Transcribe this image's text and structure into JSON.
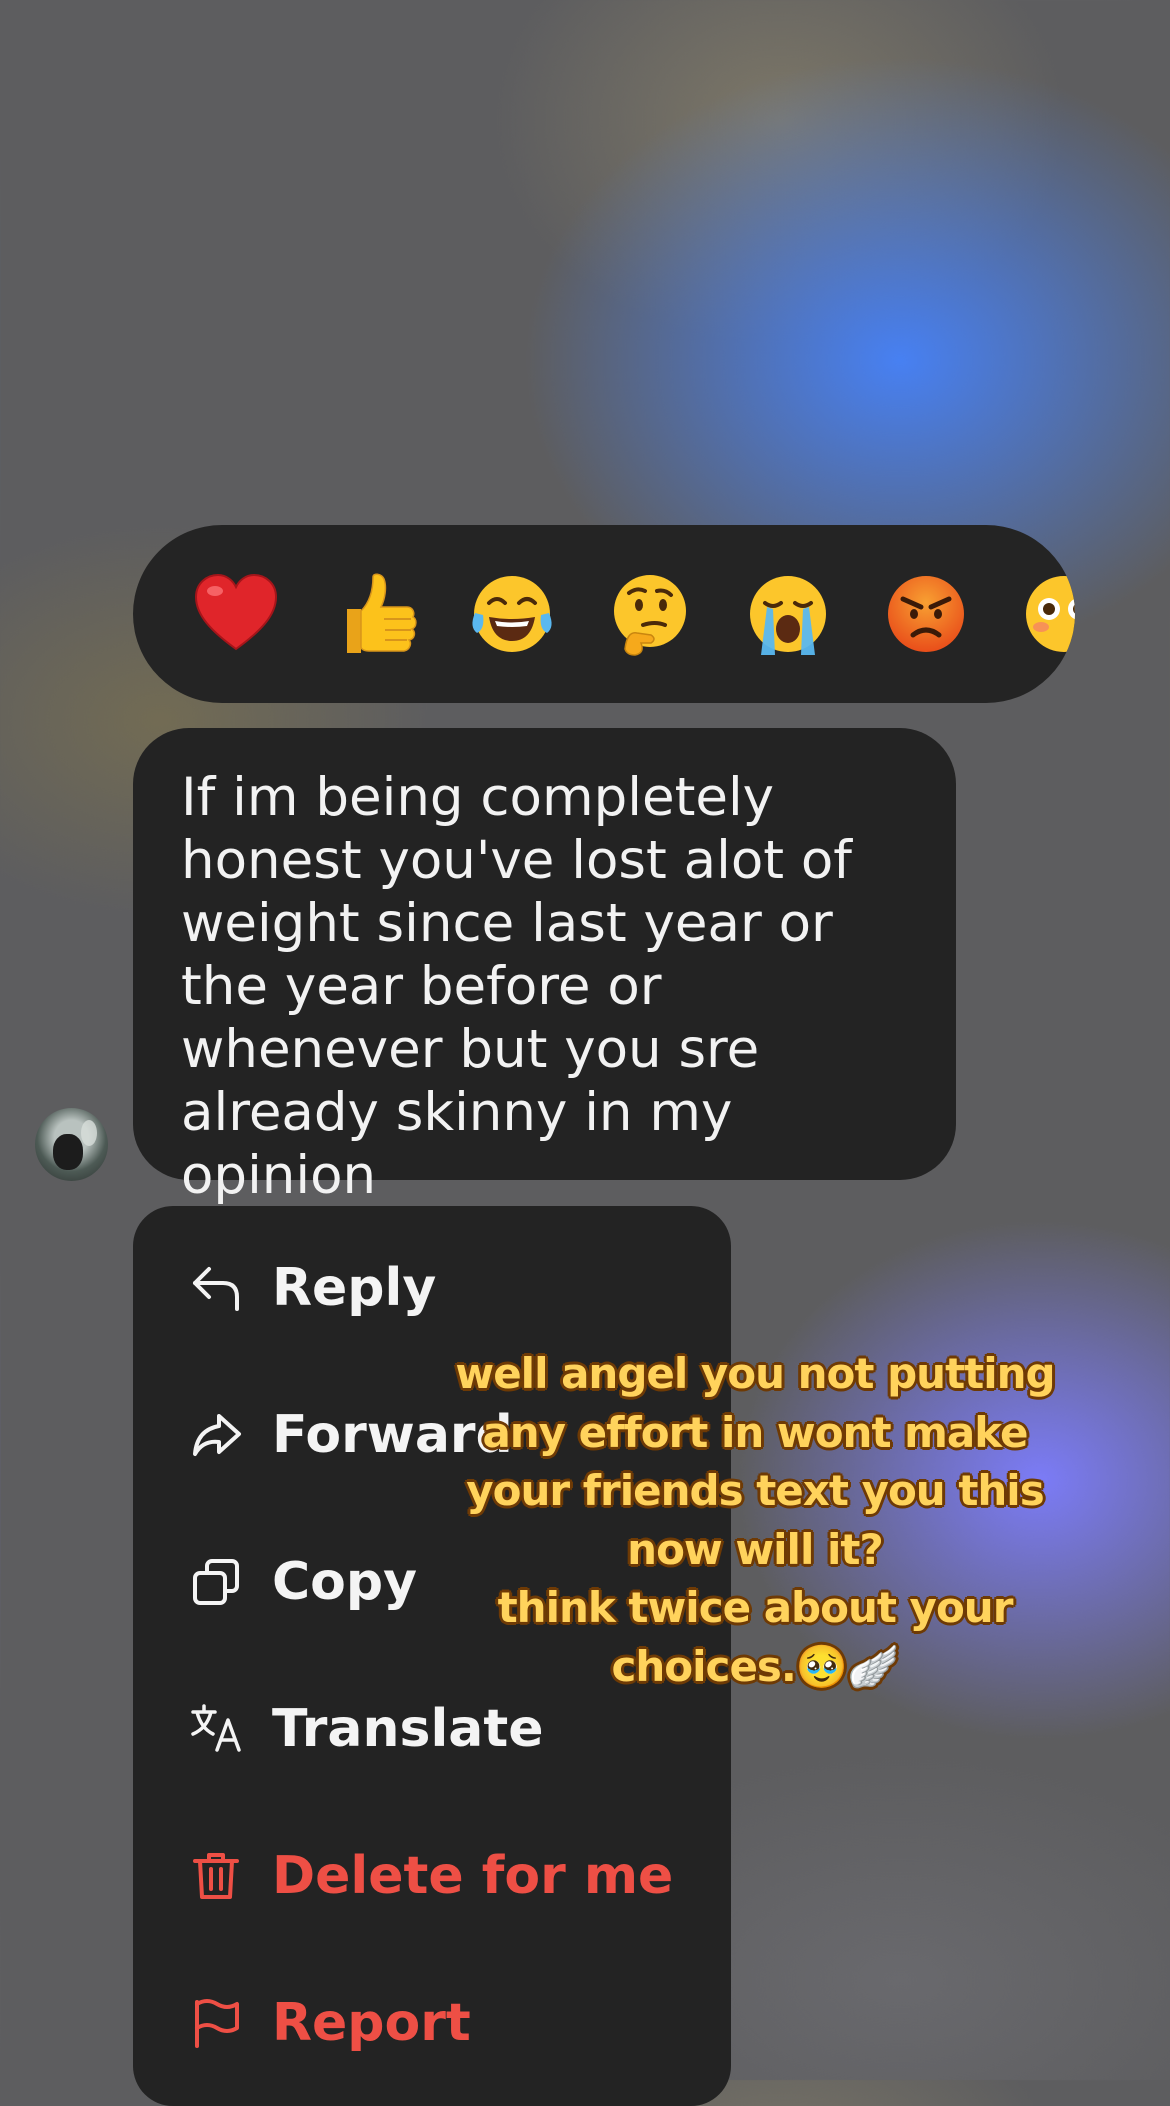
{
  "reactions": [
    {
      "name": "heart"
    },
    {
      "name": "thumbs-up"
    },
    {
      "name": "tears-of-joy"
    },
    {
      "name": "thinking-face"
    },
    {
      "name": "crying-face"
    },
    {
      "name": "angry-face"
    },
    {
      "name": "flushed-face"
    }
  ],
  "message": {
    "text": "If im being completely honest you've lost alot of weight since last year or the year before or whenever but you sre already skinny in my opinion"
  },
  "menu": {
    "items": [
      {
        "label": "Reply",
        "icon": "reply-icon"
      },
      {
        "label": "Forward",
        "icon": "forward-icon"
      },
      {
        "label": "Copy",
        "icon": "copy-icon"
      },
      {
        "label": "Translate",
        "icon": "translate-icon"
      },
      {
        "label": "Delete for me",
        "icon": "trash-icon"
      },
      {
        "label": "Report",
        "icon": "flag-icon"
      }
    ]
  },
  "caption": {
    "lines": [
      "well angel you not putting",
      "any effort in wont make",
      "your friends text you this",
      "now will it?",
      "think twice about your",
      "choices.🥹🪽"
    ]
  },
  "colors": {
    "danger": "#ee4f45",
    "panel": "#232323",
    "caption_fill": "#ffd35c",
    "caption_outline": "#6e3a05"
  }
}
